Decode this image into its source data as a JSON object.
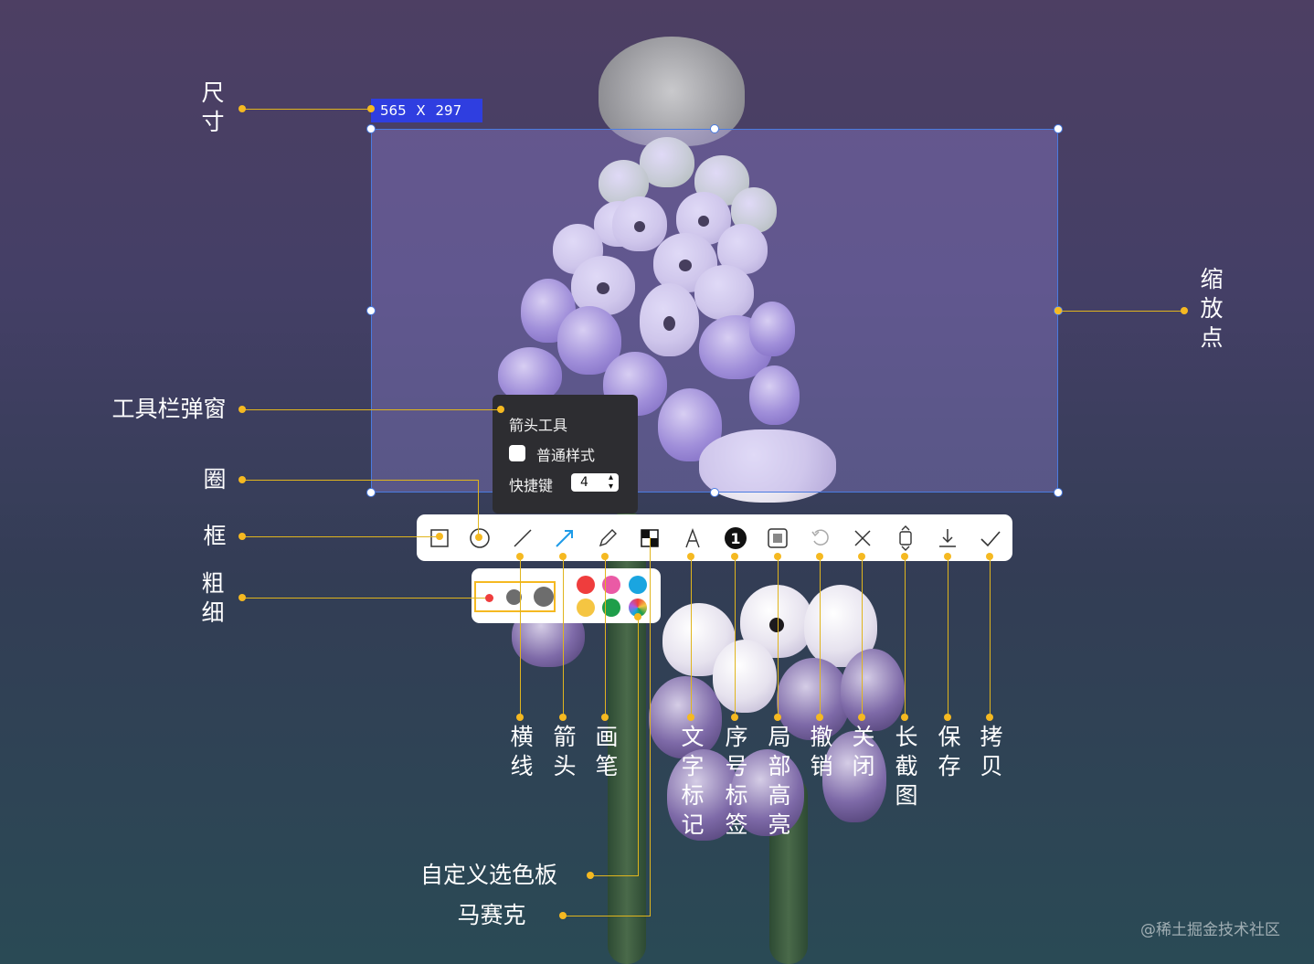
{
  "size_badge": {
    "width": "565",
    "sep": "X",
    "height": "297"
  },
  "annotations_left": {
    "size": "尺寸",
    "toolbar_popup": "工具栏弹窗",
    "circle": "圈",
    "frame": "框",
    "thickness": "粗细"
  },
  "annotations_right": {
    "resize_handle": "缩放点"
  },
  "annotations_bottom": {
    "line": "横线",
    "arrow": "箭头",
    "pen": "画笔",
    "text": "文字标记",
    "serial": "序号标签",
    "highlight": "局部高亮",
    "undo": "撤销",
    "close": "关闭",
    "long_screenshot": "长截图",
    "save": "保存",
    "copy": "拷贝",
    "custom_palette": "自定义选色板",
    "mosaic": "马赛克"
  },
  "popup": {
    "title": "箭头工具",
    "option": "普通样式",
    "shortcut_label": "快捷键",
    "shortcut_value": "4"
  },
  "toolbar": {
    "icons": [
      "rectangle-icon",
      "ellipse-icon",
      "line-icon",
      "arrow-icon",
      "pen-icon",
      "mosaic-icon",
      "text-icon",
      "serial-number-icon",
      "highlight-icon",
      "undo-icon",
      "close-icon",
      "long-screenshot-icon",
      "save-icon",
      "copy-icon"
    ],
    "active": "arrow-icon",
    "accent": "#1e9be8"
  },
  "palette": {
    "sizes": [
      "small",
      "medium",
      "large"
    ],
    "selected_size": "small",
    "colors": [
      "#ef3d3d",
      "#ea5aa5",
      "#1aa5e0",
      "#f5c542",
      "#1f9e4a",
      "custom-gradient"
    ],
    "selected_color": "#ef3d3d"
  },
  "colors": {
    "callout": "#f5b921",
    "selection_border": "#4a7be0",
    "size_badge_bg": "#2f3ee0"
  },
  "watermark": "@稀土掘金技术社区"
}
